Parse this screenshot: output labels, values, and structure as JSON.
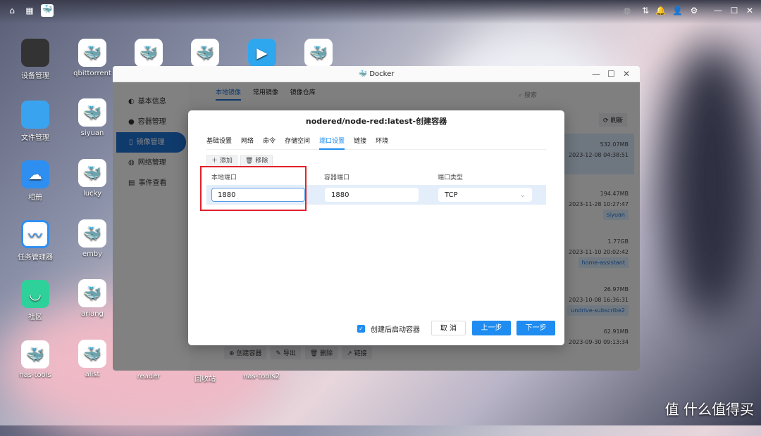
{
  "desktop": {
    "col1": [
      {
        "label": "设备管理",
        "icon": "device-icon"
      },
      {
        "label": "文件管理",
        "icon": "folder-icon"
      },
      {
        "label": "相册",
        "icon": "photos-icon"
      },
      {
        "label": "任务管理器",
        "icon": "task-manager-icon"
      },
      {
        "label": "社区",
        "icon": "community-icon"
      },
      {
        "label": "nas-tools",
        "icon": "docker-icon"
      }
    ],
    "col2": [
      {
        "label": "qbittorrent"
      },
      {
        "label": "siyuan"
      },
      {
        "label": "lucky"
      },
      {
        "label": "emby"
      },
      {
        "label": "ariang"
      },
      {
        "label": "alist"
      }
    ],
    "bottom": [
      {
        "label": "reader"
      },
      {
        "label": "回收站"
      },
      {
        "label": "nas-tools2"
      }
    ]
  },
  "window": {
    "title": "Docker",
    "sidebar": [
      {
        "label": "基本信息",
        "icon": "info-icon"
      },
      {
        "label": "容器管理",
        "icon": "container-icon"
      },
      {
        "label": "镜像管理",
        "icon": "image-icon"
      },
      {
        "label": "网络管理",
        "icon": "network-icon"
      },
      {
        "label": "事件查看",
        "icon": "event-icon"
      }
    ],
    "tabs": [
      "本地镜像",
      "常用镜像",
      "镜像仓库"
    ],
    "search_placeholder": "搜索",
    "refresh": "刷新",
    "images": [
      {
        "size": "532.07MB",
        "date": "2023-12-08 04:38:51",
        "tag": ""
      },
      {
        "size": "194.47MB",
        "date": "2023-11-28 10:27:47",
        "tag": "siyuan"
      },
      {
        "size": "1.77GB",
        "date": "2023-11-10 20:02:42",
        "tag": "home-assistant"
      },
      {
        "size": "26.97MB",
        "date": "2023-10-08 16:36:31",
        "tag": "undrive-subscribe2"
      },
      {
        "size": "62.91MB",
        "date": "2023-09-30 09:13:34",
        "tag": ""
      }
    ],
    "footer": [
      "创建容器",
      "导出",
      "删除",
      "链接"
    ]
  },
  "modal": {
    "title": "nodered/node-red:latest-创建容器",
    "tabs": [
      "基础设置",
      "网络",
      "命令",
      "存储空间",
      "端口设置",
      "链接",
      "环境"
    ],
    "active_tab": "端口设置",
    "add": "添加",
    "remove": "移除",
    "columns": [
      "本地端口",
      "容器端口",
      "端口类型"
    ],
    "row": {
      "local": "1880",
      "container": "1880",
      "type": "TCP"
    },
    "autostart_label": "创建后启动容器",
    "autostart": true,
    "cancel": "取 消",
    "prev": "上一步",
    "next": "下一步"
  },
  "watermark": "值 什么值得买"
}
